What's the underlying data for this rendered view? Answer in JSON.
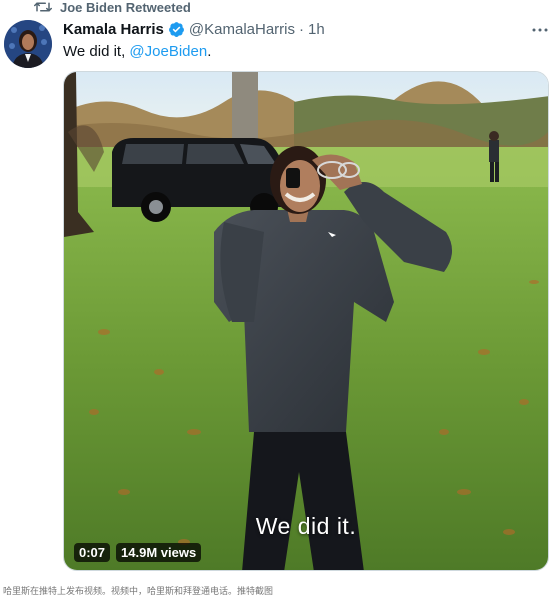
{
  "retweet": {
    "label": "Joe Biden Retweeted"
  },
  "author": {
    "name": "Kamala Harris",
    "handle": "@KamalaHarris",
    "separator": "·",
    "time": "1h"
  },
  "tweet": {
    "text_prefix": "We did it, ",
    "mention": "@JoeBiden",
    "text_suffix": "."
  },
  "video": {
    "caption": "We did it.",
    "duration": "0:07",
    "views": "14.9M views"
  },
  "page_caption": "哈里斯在推特上发布视频。视频中，哈里斯和拜登通电话。推特截图",
  "colors": {
    "verified": "#1d9bf0",
    "mention": "#1d9bf0",
    "muted": "#536471"
  },
  "icons": {
    "retweet": "retweet-icon",
    "verified": "verified-badge-icon",
    "more": "more-icon"
  }
}
